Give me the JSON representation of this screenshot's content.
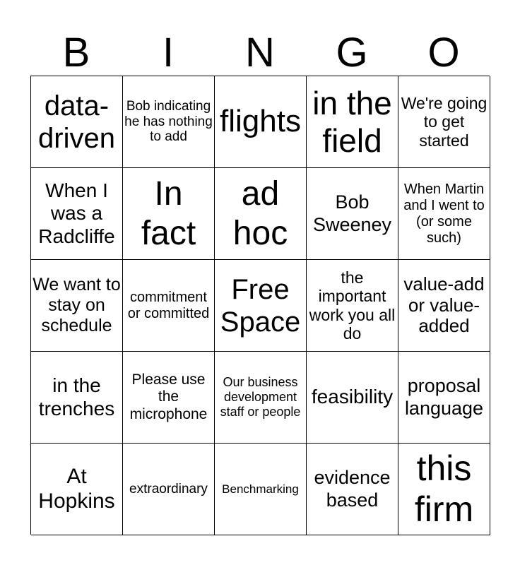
{
  "header": [
    "B",
    "I",
    "N",
    "G",
    "O"
  ],
  "cells": [
    "data-driven",
    "Bob indicating he has nothing to add",
    "flights",
    "in the field",
    "We're going to get started",
    "When I was a Radcliffe",
    "In fact",
    "ad hoc",
    "Bob Sweeney",
    "When Martin and I went to (or some such)",
    "We want to stay on schedule",
    "commitment or committed",
    "Free Space",
    "the important work you all do",
    "value-add or value-added",
    "in the trenches",
    "Please use the microphone",
    "Our business development staff or people",
    "feasibility",
    "proposal language",
    "At Hopkins",
    "extraordinary",
    "Benchmarking",
    "evidence based",
    "this firm"
  ]
}
